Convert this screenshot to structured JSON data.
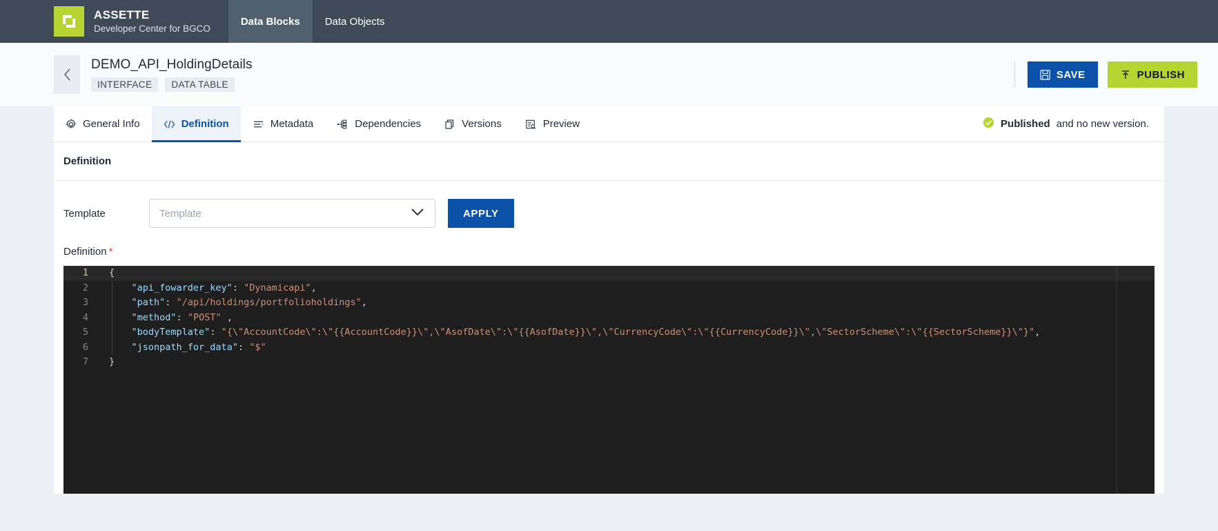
{
  "topnav": {
    "brand_title": "ASSETTE",
    "brand_subtitle": "Developer Center for BGCO",
    "logo_icon": "overlapping-squares-logo",
    "tabs": [
      {
        "label": "Data Blocks",
        "active": true
      },
      {
        "label": "Data Objects",
        "active": false
      }
    ]
  },
  "page_header": {
    "back_icon": "chevron-left-icon",
    "title": "DEMO_API_HoldingDetails",
    "chips": [
      "INTERFACE",
      "DATA TABLE"
    ],
    "save_label": "SAVE",
    "save_icon": "floppy-disk-icon",
    "publish_label": "PUBLISH",
    "publish_icon": "upload-arrow-icon"
  },
  "tabstrip": {
    "tabs": [
      {
        "label": "General Info",
        "icon": "gear-icon",
        "active": false
      },
      {
        "label": "Definition",
        "icon": "code-brackets-icon",
        "active": true
      },
      {
        "label": "Metadata",
        "icon": "list-lines-icon",
        "active": false
      },
      {
        "label": "Dependencies",
        "icon": "hierarchy-icon",
        "active": false
      },
      {
        "label": "Versions",
        "icon": "copy-stack-icon",
        "active": false
      },
      {
        "label": "Preview",
        "icon": "document-search-icon",
        "active": false
      }
    ],
    "status_icon": "check-circle-icon",
    "status_strong": "Published",
    "status_rest": " and no new version."
  },
  "definition_panel": {
    "heading": "Definition",
    "template_label": "Template",
    "template_placeholder": "Template",
    "template_value": "",
    "dropdown_icon": "chevron-down-icon",
    "apply_label": "APPLY",
    "definition_label": "Definition",
    "required_marker": "*",
    "editor": {
      "language": "json",
      "active_line": 1,
      "lines": [
        {
          "n": "1",
          "tokens": [
            {
              "t": "{",
              "c": "br"
            }
          ]
        },
        {
          "n": "2",
          "tokens": [
            {
              "t": "    ",
              "c": "p"
            },
            {
              "t": "\"api_fowarder_key\"",
              "c": "k"
            },
            {
              "t": ": ",
              "c": "p"
            },
            {
              "t": "\"Dynamicapi\"",
              "c": "s"
            },
            {
              "t": ",",
              "c": "p"
            }
          ]
        },
        {
          "n": "3",
          "tokens": [
            {
              "t": "    ",
              "c": "p"
            },
            {
              "t": "\"path\"",
              "c": "k"
            },
            {
              "t": ": ",
              "c": "p"
            },
            {
              "t": "\"/api/holdings/portfolioholdings\"",
              "c": "s"
            },
            {
              "t": ",",
              "c": "p"
            }
          ]
        },
        {
          "n": "4",
          "tokens": [
            {
              "t": "    ",
              "c": "p"
            },
            {
              "t": "\"method\"",
              "c": "k"
            },
            {
              "t": ": ",
              "c": "p"
            },
            {
              "t": "\"POST\"",
              "c": "s"
            },
            {
              "t": " ,",
              "c": "p"
            }
          ]
        },
        {
          "n": "5",
          "tokens": [
            {
              "t": "    ",
              "c": "p"
            },
            {
              "t": "\"bodyTemplate\"",
              "c": "k"
            },
            {
              "t": ": ",
              "c": "p"
            },
            {
              "t": "\"{\\\"AccountCode\\\":\\\"{{AccountCode}}\\\",\\\"AsofDate\\\":\\\"{{AsofDate}}\\\",\\\"CurrencyCode\\\":\\\"{{CurrencyCode}}\\\",\\\"SectorScheme\\\":\\\"{{SectorScheme}}\\\"}\"",
              "c": "s"
            },
            {
              "t": ",",
              "c": "p"
            }
          ]
        },
        {
          "n": "6",
          "tokens": [
            {
              "t": "    ",
              "c": "p"
            },
            {
              "t": "\"jsonpath_for_data\"",
              "c": "k"
            },
            {
              "t": ": ",
              "c": "p"
            },
            {
              "t": "\"$\"",
              "c": "s"
            }
          ]
        },
        {
          "n": "7",
          "tokens": [
            {
              "t": "}",
              "c": "br"
            }
          ]
        }
      ]
    }
  },
  "colors": {
    "nav_bg": "#3e4a58",
    "nav_active_bg": "#51606e",
    "brand_green": "#b7d432",
    "accent_blue": "#0b52a8",
    "editor_bg": "#1e1e1e",
    "required_red": "#e8413a",
    "page_bg": "#eceff3"
  }
}
